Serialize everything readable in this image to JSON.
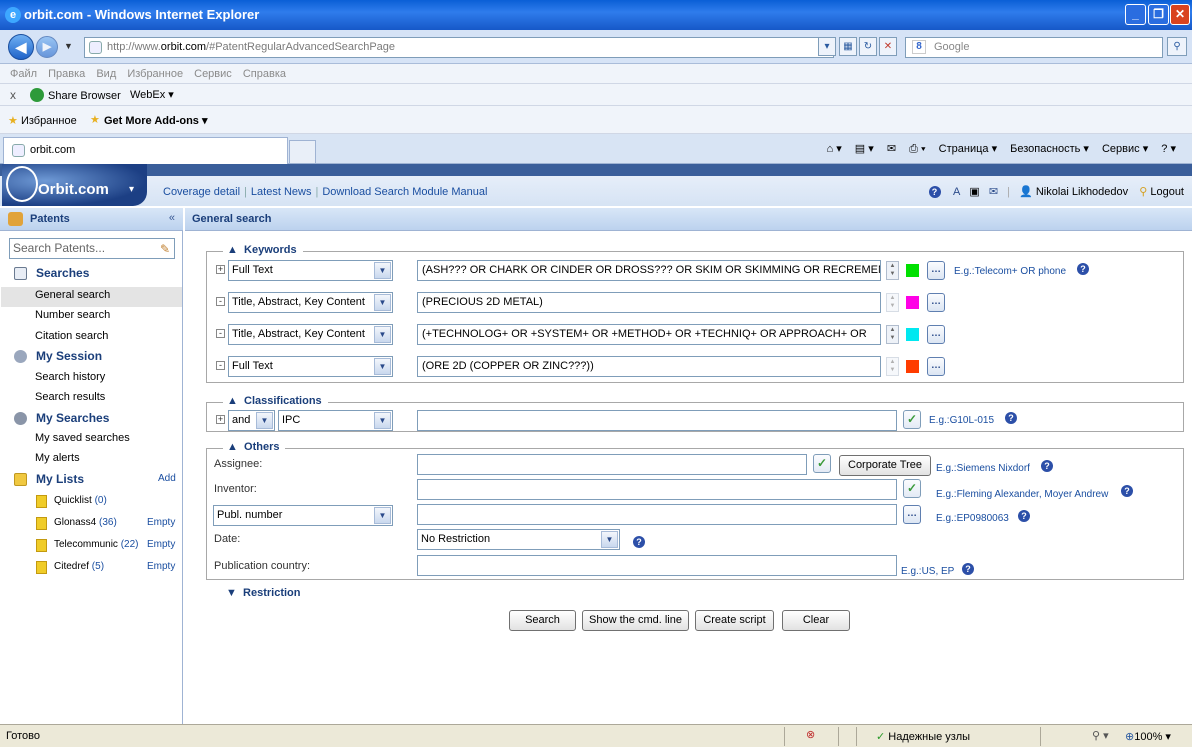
{
  "browser": {
    "title": "orbit.com - Windows Internet Explorer",
    "url_prefix": "http://www.",
    "url_domain": "orbit.com",
    "url_rest": "/#PatentRegularAdvancedSearchPage",
    "search_placeholder": "Google",
    "menu": [
      "Файл",
      "Правка",
      "Вид",
      "Избранное",
      "Сервис",
      "Справка"
    ],
    "links": {
      "close": "x",
      "share_browser": "Share Browser",
      "webex": "WebEx ▾"
    },
    "favorites_label": "Избранное",
    "addons_label": "Get More Add-ons ▾",
    "tab_label": "orbit.com",
    "cmd": {
      "page": "Страница ▾",
      "security": "Безопасность ▾",
      "service": "Сервис ▾"
    },
    "status": "Готово",
    "trusted": "Надежные узлы",
    "zoom": "100%"
  },
  "app": {
    "logo": "Orbit.com",
    "nav_links": [
      "Coverage detail",
      "Latest News",
      "Download Search Module Manual"
    ],
    "user": "Nikolai Likhodedov",
    "logout": "Logout"
  },
  "sidebar": {
    "title": "Patents",
    "collapse": "«",
    "search_placeholder": "Search Patents...",
    "sections": {
      "searches": "Searches",
      "session": "My Session",
      "my_searches": "My Searches",
      "lists": "My Lists"
    },
    "search_items": [
      "General search",
      "Number search",
      "Citation search"
    ],
    "session_items": [
      "Search history",
      "Search results"
    ],
    "my_search_items": [
      "My saved searches",
      "My alerts"
    ],
    "lists_add": "Add",
    "lists": [
      {
        "name": "Quicklist",
        "count": "(0)",
        "action": ""
      },
      {
        "name": "Glonass4",
        "count": "(36)",
        "action": "Empty"
      },
      {
        "name": "Telecommunic",
        "count": "(22)",
        "action": "Empty"
      },
      {
        "name": "Citedref",
        "count": "(5)",
        "action": "Empty"
      }
    ]
  },
  "main": {
    "title": "General search",
    "keywords": {
      "legend": "Keywords",
      "rows": [
        {
          "field": "Full Text",
          "query": "(ASH??? OR CHARK OR CINDER OR DROSS??? OR SKIM OR SKIMMING OR RECREMENT",
          "color": "#00e000"
        },
        {
          "field": "Title, Abstract, Key Content",
          "query": "(PRECIOUS 2D METAL)",
          "color": "#ff00e6"
        },
        {
          "field": "Title, Abstract, Key Content",
          "query": "(+TECHNOLOG+ OR +SYSTEM+ OR +METHOD+ OR +TECHNIQ+ OR APPROACH+ OR",
          "color": "#00e8f0"
        },
        {
          "field": "Full Text",
          "query": "(ORE 2D (COPPER OR ZINC???))",
          "color": "#ff3c00"
        }
      ],
      "example": "E.g.:Telecom+ OR phone"
    },
    "classifications": {
      "legend": "Classifications",
      "operator": "and",
      "scheme": "IPC",
      "value": "",
      "example": "E.g.:G10L-015"
    },
    "others": {
      "legend": "Others",
      "assignee_label": "Assignee:",
      "corporate_tree": "Corporate Tree",
      "assignee_example": "E.g.:Siemens Nixdorf",
      "inventor_label": "Inventor:",
      "inventor_example": "E.g.:Fleming Alexander, Moyer Andrew",
      "publ_select": "Publ. number",
      "publ_example": "E.g.:EP0980063",
      "date_label": "Date:",
      "date_value": "No Restriction",
      "country_label": "Publication country:",
      "country_example": "E.g.:US, EP"
    },
    "restriction": "Restriction",
    "buttons": {
      "search": "Search",
      "cmd_line": "Show the cmd. line",
      "script": "Create script",
      "clear": "Clear"
    }
  }
}
